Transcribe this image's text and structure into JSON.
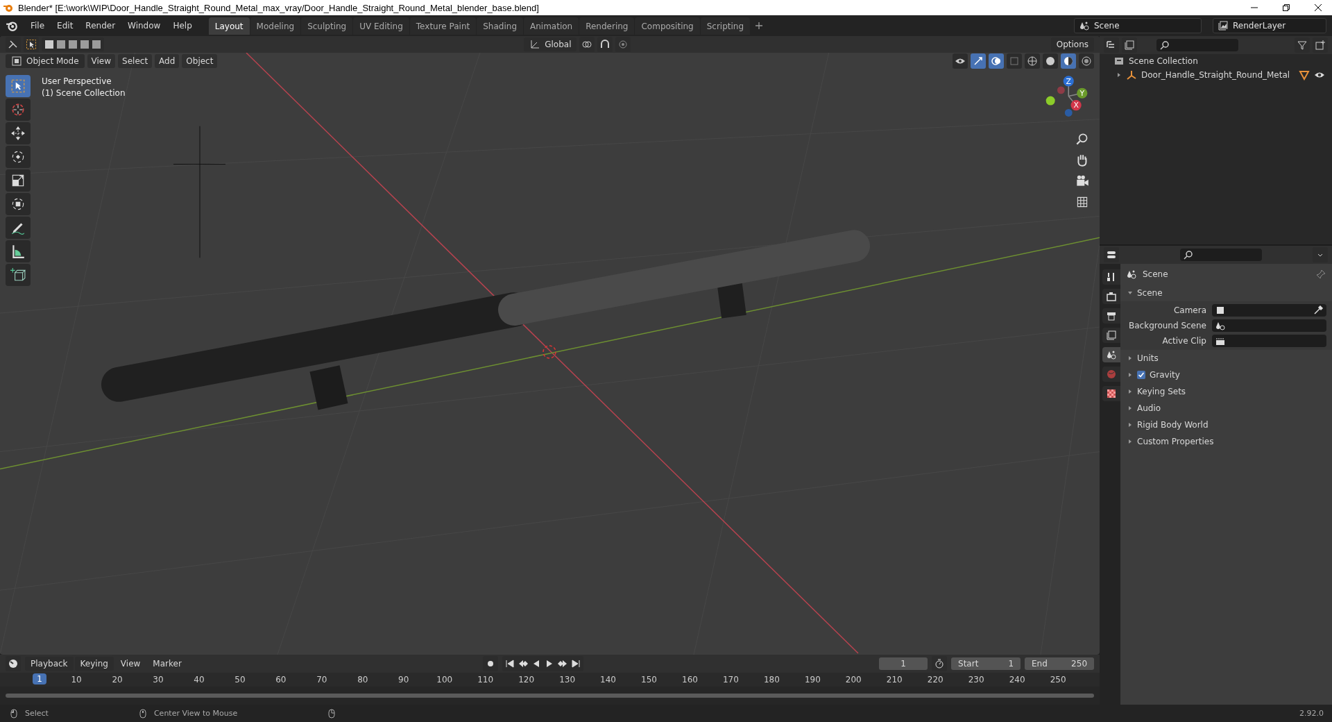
{
  "window": {
    "title": "Blender* [E:\\work\\WIP\\Door_Handle_Straight_Round_Metal_max_vray/Door_Handle_Straight_Round_Metal_blender_base.blend]"
  },
  "menu": [
    "File",
    "Edit",
    "Render",
    "Window",
    "Help"
  ],
  "workspaces": [
    {
      "label": "Layout",
      "selected": true
    },
    {
      "label": "Modeling",
      "selected": false
    },
    {
      "label": "Sculpting",
      "selected": false
    },
    {
      "label": "UV Editing",
      "selected": false
    },
    {
      "label": "Texture Paint",
      "selected": false
    },
    {
      "label": "Shading",
      "selected": false
    },
    {
      "label": "Animation",
      "selected": false
    },
    {
      "label": "Rendering",
      "selected": false
    },
    {
      "label": "Compositing",
      "selected": false
    },
    {
      "label": "Scripting",
      "selected": false
    }
  ],
  "scene_field": {
    "value": "Scene"
  },
  "view_layer_field": {
    "value": "RenderLayer"
  },
  "tool_header": {
    "orientation": "Global",
    "options": "Options"
  },
  "viewport_header": {
    "mode": "Object Mode",
    "menus": [
      "View",
      "Select",
      "Add",
      "Object"
    ]
  },
  "viewport": {
    "overlay_text": [
      "User Perspective",
      "(1) Scene Collection"
    ],
    "gizmo_axes": [
      "Z",
      "Y",
      "X"
    ]
  },
  "tools": [
    {
      "kind": "select",
      "selected": true
    },
    {
      "kind": "cursor",
      "selected": false
    },
    {
      "kind": "move",
      "selected": false
    },
    {
      "kind": "rotate",
      "selected": false
    },
    {
      "kind": "scale",
      "selected": false
    },
    {
      "kind": "transform",
      "selected": false
    },
    {
      "kind": "annotate",
      "selected": false
    },
    {
      "kind": "measure",
      "selected": false
    },
    {
      "kind": "add-cube",
      "selected": false
    }
  ],
  "outliner": {
    "items": [
      {
        "label": "Scene Collection",
        "children": [
          {
            "label": "Door_Handle_Straight_Round_Metal",
            "expanded": false,
            "visible": true
          }
        ]
      }
    ]
  },
  "properties": {
    "tabs": [
      {
        "kind": "tool",
        "selected": false
      },
      {
        "kind": "render",
        "selected": false
      },
      {
        "kind": "output",
        "selected": false
      },
      {
        "kind": "view-layer",
        "selected": false
      },
      {
        "kind": "scene",
        "selected": true
      },
      {
        "kind": "world",
        "selected": false
      },
      {
        "kind": "texture",
        "selected": false
      }
    ],
    "title": "Scene",
    "section": {
      "label": "Scene",
      "expanded": true,
      "fields": [
        {
          "label": "Camera"
        },
        {
          "label": "Background Scene"
        },
        {
          "label": "Active Clip"
        }
      ]
    },
    "panels": [
      {
        "label": "Units",
        "kind": "plain"
      },
      {
        "label": "Gravity",
        "kind": "checkbox",
        "checked": true
      },
      {
        "label": "Keying Sets",
        "kind": "plain"
      },
      {
        "label": "Audio",
        "kind": "plain"
      },
      {
        "label": "Rigid Body World",
        "kind": "plain"
      },
      {
        "label": "Custom Properties",
        "kind": "plain"
      }
    ]
  },
  "timeline": {
    "menus": [
      "Playback",
      "Keying",
      "View",
      "Marker"
    ],
    "current_frame": "1",
    "start_label": "Start",
    "start": "1",
    "end_label": "End",
    "end": "250",
    "playhead": "1",
    "ruler": [
      "10",
      "20",
      "30",
      "40",
      "50",
      "60",
      "70",
      "80",
      "90",
      "100",
      "110",
      "120",
      "130",
      "140",
      "150",
      "160",
      "170",
      "180",
      "190",
      "200",
      "210",
      "220",
      "230",
      "240",
      "250"
    ]
  },
  "status_bar": {
    "items": [
      "Select",
      "Center View to Mouse"
    ],
    "version": "2.92.0"
  }
}
